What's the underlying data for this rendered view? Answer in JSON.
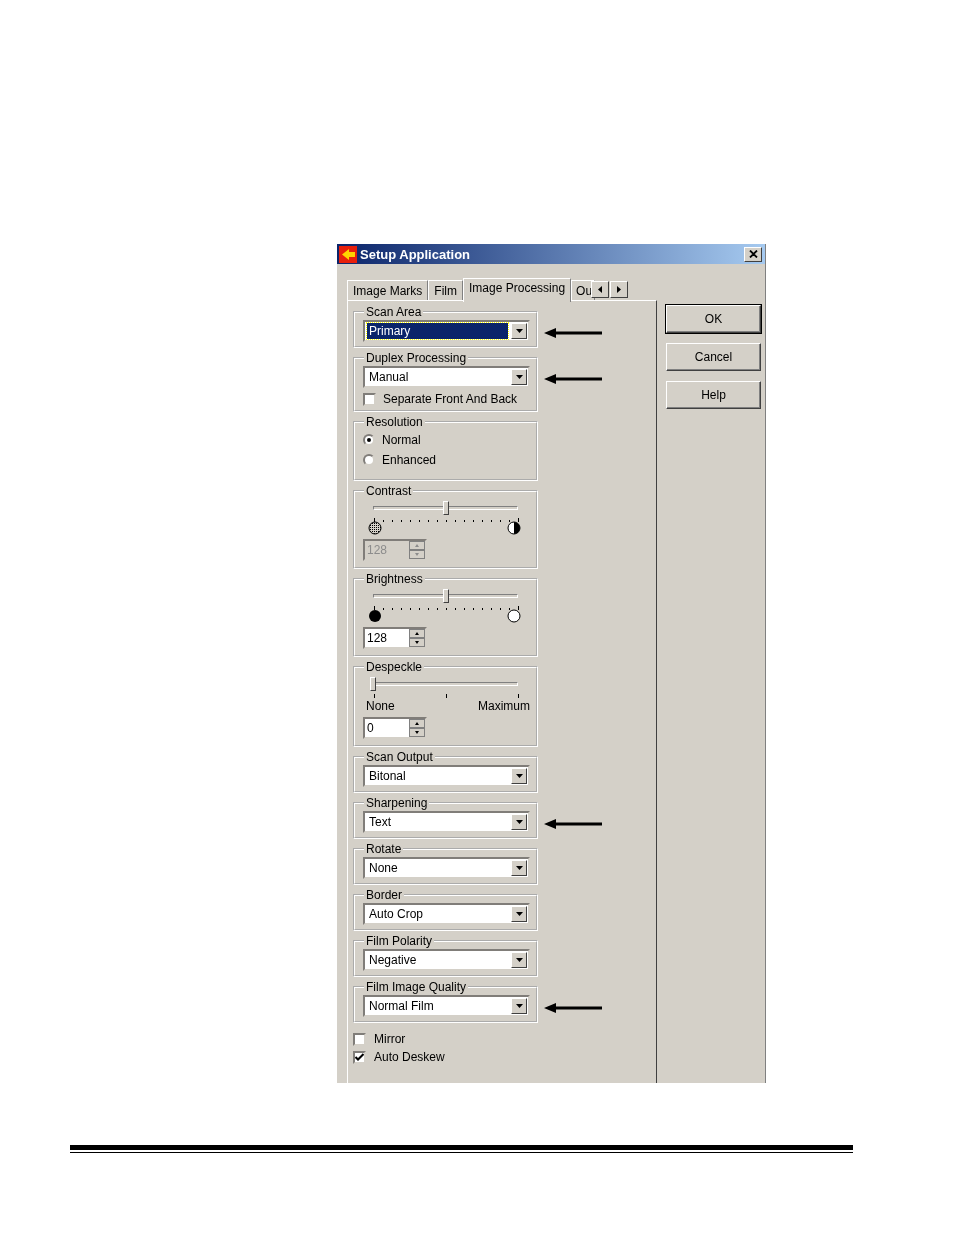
{
  "window": {
    "title": "Setup Application"
  },
  "tabs": [
    {
      "label": "Image Marks",
      "selected": false
    },
    {
      "label": "Film",
      "selected": false
    },
    {
      "label": "Image Processing",
      "selected": true
    },
    {
      "label": "Ou",
      "selected": false
    }
  ],
  "groups": [
    {
      "kind": "dropdown",
      "label": "Scan Area",
      "value": "Primary",
      "focused": true,
      "annotated": true
    },
    {
      "kind": "dropdown",
      "label": "Duplex Processing",
      "value": "Manual",
      "focused": false,
      "annotated": true,
      "checkbox": {
        "label": "Separate Front And Back",
        "checked": false
      }
    },
    {
      "kind": "radio",
      "label": "Resolution",
      "options": [
        {
          "label": "Normal",
          "selected": true
        },
        {
          "label": "Enhanced",
          "selected": false
        }
      ]
    },
    {
      "kind": "contrast",
      "label": "Contrast",
      "level": 0.5,
      "spinner": {
        "value": "128",
        "disabled": true
      }
    },
    {
      "kind": "brightness",
      "label": "Brightness",
      "level": 0.5,
      "spinner": {
        "value": "128",
        "disabled": false
      }
    },
    {
      "kind": "range",
      "label": "Despeckle",
      "level": 0,
      "min_label": "None",
      "max_label": "Maximum",
      "spinner": {
        "value": "0",
        "disabled": false
      }
    },
    {
      "kind": "dropdown",
      "label": "Scan Output",
      "value": "Bitonal",
      "focused": false,
      "annotated": false
    },
    {
      "kind": "dropdown",
      "label": "Sharpening",
      "value": "Text",
      "focused": false,
      "annotated": true
    },
    {
      "kind": "dropdown",
      "label": "Rotate",
      "value": "None",
      "focused": false,
      "annotated": false
    },
    {
      "kind": "dropdown",
      "label": "Border",
      "value": "Auto Crop",
      "focused": false,
      "annotated": false
    },
    {
      "kind": "dropdown",
      "label": "Film Polarity",
      "value": "Negative",
      "focused": false,
      "annotated": false
    },
    {
      "kind": "dropdown",
      "label": "Film Image Quality",
      "value": "Normal Film",
      "focused": false,
      "annotated": true
    }
  ],
  "checkboxes": [
    {
      "label": "Mirror",
      "checked": false
    },
    {
      "label": "Auto Deskew",
      "checked": true
    }
  ],
  "buttons": [
    "OK",
    "Cancel",
    "Help"
  ]
}
